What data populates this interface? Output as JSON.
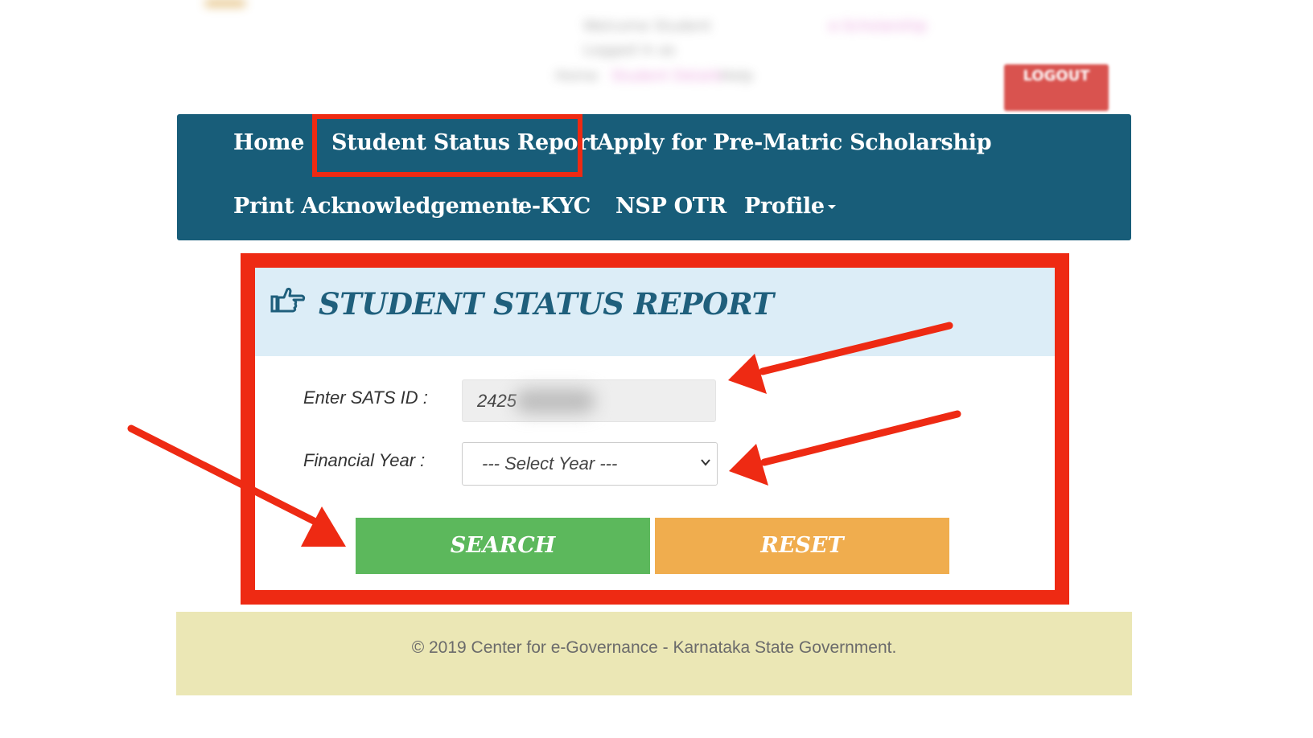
{
  "header": {
    "blurred_text": [
      "Welcome Student",
      "Logged in as",
      "Home",
      "Student Details",
      "Help",
      "e-Scholarship"
    ],
    "logout_label": "LOGOUT"
  },
  "nav": {
    "items": [
      {
        "label": "Home"
      },
      {
        "label": "Student Status Report"
      },
      {
        "label": "Apply for Pre-Matric Scholarship"
      },
      {
        "label": "Print Acknowledgement"
      },
      {
        "label": "e-KYC"
      },
      {
        "label": "NSP OTR"
      },
      {
        "label": "Profile"
      }
    ]
  },
  "panel": {
    "title": "STUDENT STATUS REPORT",
    "sats_label": "Enter SATS ID :",
    "sats_value": "2425",
    "year_label": "Financial Year :",
    "year_selected": "--- Select Year ---",
    "search_label": "SEARCH",
    "reset_label": "RESET"
  },
  "footer": {
    "text": "© 2019 Center for e-Governance - Karnataka State Government."
  },
  "colors": {
    "nav_bg": "#185d79",
    "annotation_red": "#ee2a13",
    "panel_head_bg": "#dcedf7",
    "search_green": "#5cb85c",
    "reset_orange": "#f0ad4e",
    "footer_bg": "#ebe7b5",
    "logout_red": "#d9534f"
  }
}
